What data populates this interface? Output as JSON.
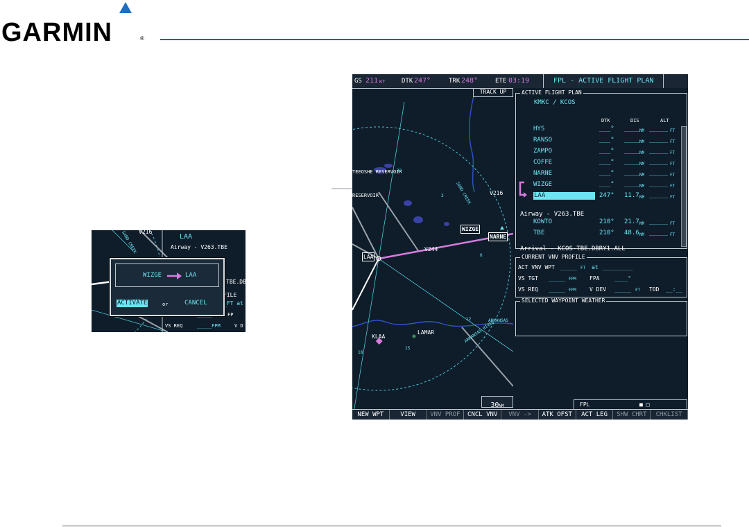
{
  "brand": {
    "name": "GARMIN",
    "registered": "®"
  },
  "topbar": {
    "gs_label": "GS",
    "gs_value": "211",
    "gs_unit": "KT",
    "dtk_label": "DTK",
    "dtk_value": "247°",
    "trk_label": "TRK",
    "trk_value": "248°",
    "ete_label": "ETE",
    "ete_value": "03:19",
    "page_title": "FPL - ACTIVE FLIGHT PLAN"
  },
  "map": {
    "orientation": "TRACK UP",
    "range": "30",
    "range_unit": "NM",
    "labels": {
      "reservoir1": "TEEOSHE RESERVOIR",
      "reservoir2": "RESERVOIR",
      "airway_v216": "V216",
      "airway_v244": "V244",
      "wizge": "WIZGE",
      "narne": "NARNE",
      "laa": "LAA",
      "klaa": "KLAA",
      "lamar": "LAMAR",
      "arkansas": "ARKANSAS",
      "arkansas_river": "ARKANSAS RIVER",
      "sand_creek": "SAND CREEK",
      "ring_3": "3",
      "ring_6": "6",
      "ring_12": "12",
      "ring_15": "15",
      "ring_18": "18",
      "ring_33": "33"
    }
  },
  "fpl": {
    "section_title": "ACTIVE FLIGHT PLAN",
    "route": "KMKC / KCOS",
    "columns": {
      "dtk": "DTK",
      "dis": "DIS",
      "alt": "ALT"
    },
    "rows": [
      {
        "name": "HYS",
        "dtk": "___°",
        "dis": "____",
        "dis_unit": "NM",
        "alt": "_____",
        "alt_unit": "FT"
      },
      {
        "name": "RANSO",
        "dtk": "___°",
        "dis": "____",
        "dis_unit": "NM",
        "alt": "_____",
        "alt_unit": "FT"
      },
      {
        "name": "ZAMPO",
        "dtk": "___°",
        "dis": "____",
        "dis_unit": "NM",
        "alt": "_____",
        "alt_unit": "FT"
      },
      {
        "name": "COFFE",
        "dtk": "___°",
        "dis": "____",
        "dis_unit": "NM",
        "alt": "_____",
        "alt_unit": "FT"
      },
      {
        "name": "NARNE",
        "dtk": "___°",
        "dis": "____",
        "dis_unit": "NM",
        "alt": "_____",
        "alt_unit": "FT"
      },
      {
        "name": "WIZGE",
        "dtk": "___°",
        "dis": "____",
        "dis_unit": "NM",
        "alt": "_____",
        "alt_unit": "FT"
      },
      {
        "name": "LAA",
        "dtk": "247°",
        "dis": "11.7",
        "dis_unit": "NM",
        "alt": "_____",
        "alt_unit": "FT"
      }
    ],
    "airway": "Airway - V263.TBE",
    "airway_rows": [
      {
        "name": "KOWTO",
        "dtk": "210°",
        "dis": "21.7",
        "dis_unit": "NM",
        "alt": "_____",
        "alt_unit": "FT"
      },
      {
        "name": "TBE",
        "dtk": "210°",
        "dis": "48.6",
        "dis_unit": "NM",
        "alt": "_____",
        "alt_unit": "FT"
      }
    ],
    "arrival": "Arrival - KCOS-TBE.DBRY1.ALL"
  },
  "vnv": {
    "section_title": "CURRENT VNV PROFILE",
    "act_label": "ACT VNV WPT",
    "act_value": "_____",
    "act_unit": "FT",
    "at": "at",
    "act_wpt": "_________",
    "vs_tgt_label": "VS TGT",
    "vs_tgt_value": "_____",
    "vs_tgt_unit": "FPM",
    "fpa_label": "FPA",
    "fpa_value": "____°",
    "vs_req_label": "VS REQ",
    "vs_req_value": "_____",
    "vs_req_unit": "FPM",
    "vdev_label": "V DEV",
    "vdev_value": "_____",
    "vdev_unit": "FT",
    "tod_label": "TOD",
    "tod_value": "__:__"
  },
  "weather": {
    "section_title": "SELECTED WAYPOINT WEATHER"
  },
  "status": {
    "fpl": "FPL",
    "page_indicator": "■ □"
  },
  "softkeys": [
    {
      "label": "NEW WPT",
      "enabled": true
    },
    {
      "label": "VIEW",
      "enabled": true
    },
    {
      "label": "VNV PROF",
      "enabled": false
    },
    {
      "label": "CNCL VNV",
      "enabled": true
    },
    {
      "label": "VNV ->",
      "enabled": false
    },
    {
      "label": "ATK OFST",
      "enabled": true
    },
    {
      "label": "ACT LEG",
      "enabled": true
    },
    {
      "label": "SHW CHRT",
      "enabled": false
    },
    {
      "label": "CHKLIST",
      "enabled": false
    }
  ],
  "inset": {
    "wpt": "LAA",
    "airway": "Airway - V263.TBE",
    "airway_partial": "V216",
    "sand_creek": "SAND CREEK",
    "dialog_from": "WIZGE",
    "dialog_to": "LAA",
    "activate": "ACTIVATE",
    "or": "or",
    "cancel": "CANCEL",
    "partial_dbry": "TBE.DBRY",
    "partial_file": "FILE",
    "partial_ft_at": "_FT at",
    "vs_tgt_partial": "VS TGT",
    "vs_tgt_value": "_____FPM",
    "fpa_partial": "FP",
    "vs_req_label": "VS REQ",
    "vs_req_value": "_____FPM",
    "vdev_partial": "V D"
  }
}
